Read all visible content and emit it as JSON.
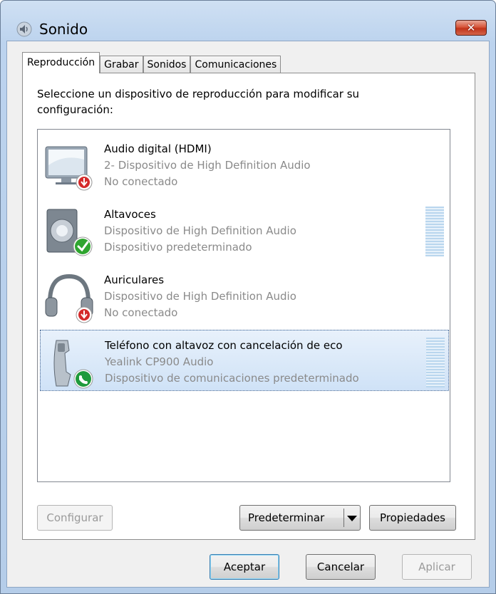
{
  "window": {
    "title": "Sonido",
    "close_label": "✕"
  },
  "tabs": [
    {
      "label": "Reproducción",
      "active": true
    },
    {
      "label": "Grabar",
      "active": false
    },
    {
      "label": "Sonidos",
      "active": false
    },
    {
      "label": "Comunicaciones",
      "active": false
    }
  ],
  "instructions": "Seleccione un dispositivo de reproducción para modificar su configuración:",
  "devices": [
    {
      "name": "Audio digital (HDMI)",
      "line2": "2- Dispositivo de High Definition Audio",
      "line3": "No conectado",
      "icon": "monitor-icon",
      "badge": "disconnected-badge-icon",
      "selected": false,
      "meter": false
    },
    {
      "name": "Altavoces",
      "line2": "Dispositivo de High Definition Audio",
      "line3": "Dispositivo predeterminado",
      "icon": "speaker-icon",
      "badge": "default-check-badge-icon",
      "selected": false,
      "meter": true
    },
    {
      "name": "Auriculares",
      "line2": "Dispositivo de High Definition Audio",
      "line3": "No conectado",
      "icon": "headphones-icon",
      "badge": "disconnected-badge-icon",
      "selected": false,
      "meter": false
    },
    {
      "name": "Teléfono con altavoz con cancelación de eco",
      "line2": "Yealink CP900 Audio",
      "line3": "Dispositivo de comunicaciones predeterminado",
      "icon": "phone-icon",
      "badge": "communications-phone-badge-icon",
      "selected": true,
      "meter": true
    }
  ],
  "buttons": {
    "configure": "Configurar",
    "set_default": "Predeterminar",
    "properties": "Propiedades",
    "ok": "Aceptar",
    "cancel": "Cancelar",
    "apply": "Aplicar"
  },
  "colors": {
    "selection": "#cfe2f7",
    "close_button": "#c1331a",
    "check_green": "#2fa52f",
    "disconnected_red": "#c8102e"
  }
}
